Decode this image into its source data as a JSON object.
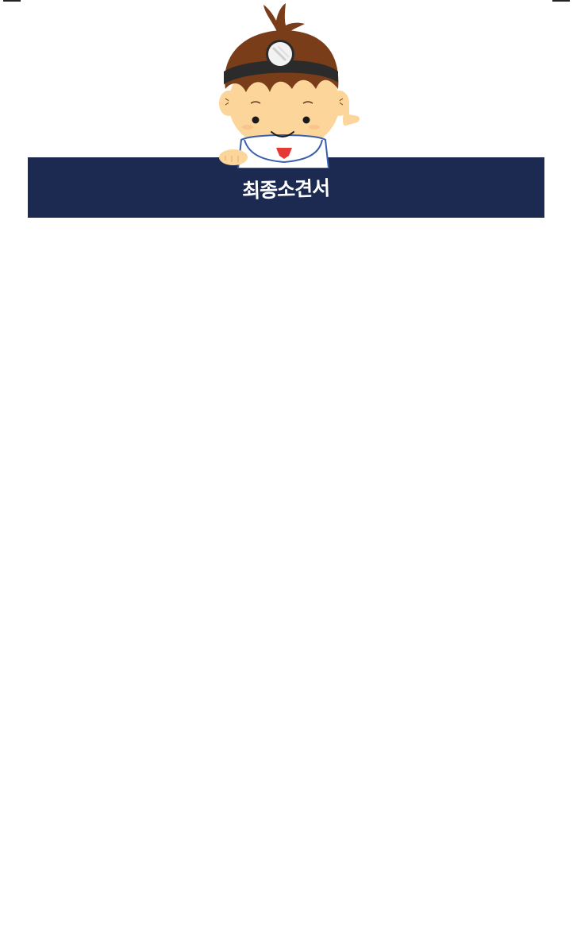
{
  "page": {
    "title": "최종소견서"
  },
  "mascot": {
    "icon": "doctor-mascot-icon"
  },
  "colors": {
    "banner_bg": "#1c2a52",
    "banner_text": "#ffffff",
    "hair": "#7a3d1a",
    "skin": "#fcd59a",
    "mirror_band": "#2b2b2b",
    "tie": "#e53935"
  }
}
